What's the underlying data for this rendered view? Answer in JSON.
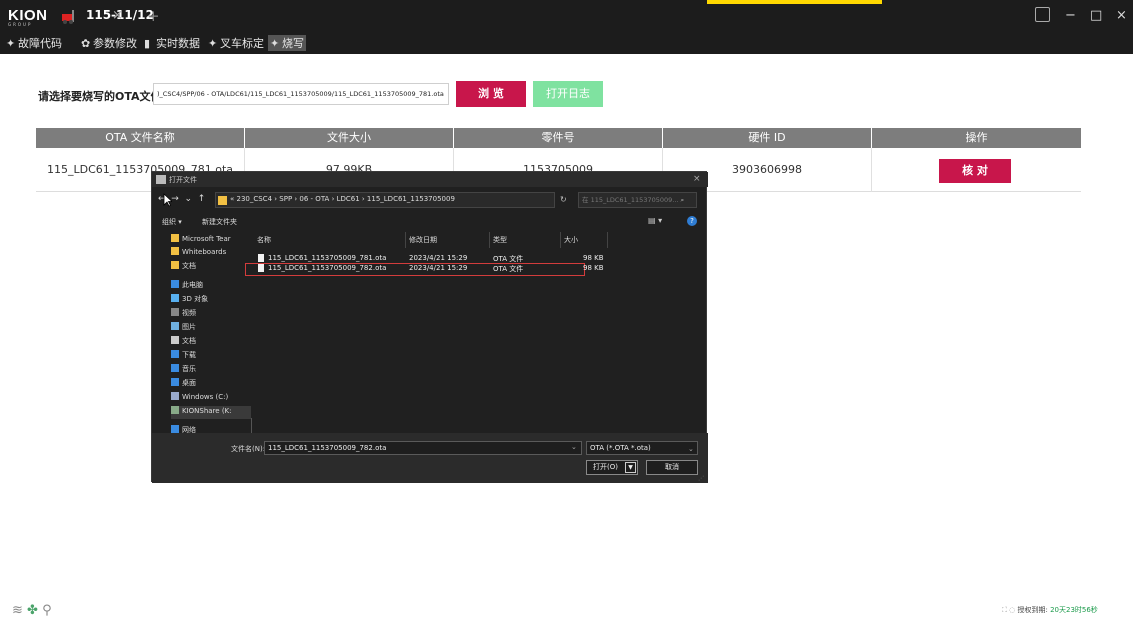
{
  "window": {
    "logo": "KION",
    "logo_sub": "GROUP",
    "tab_label": "115-11/12",
    "tab_close": "×",
    "tab_add": "+",
    "minimize": "−",
    "maximize": "□",
    "close": "×"
  },
  "menu": {
    "items": [
      {
        "label": "故障代码",
        "icon": "wrench-icon"
      },
      {
        "label": "参数修改",
        "icon": "gear-icon"
      },
      {
        "label": "实时数据",
        "icon": "bar-chart-icon"
      },
      {
        "label": "叉车标定",
        "icon": "wrench-icon"
      },
      {
        "label": "烧写",
        "icon": "flash-icon"
      }
    ],
    "active_index": 4
  },
  "main": {
    "select_label": "请选择要烧写的OTA文件",
    "path_value": ")_CSC4/SPP/06 - OTA/LDC61/115_LDC61_1153705009/115_LDC61_1153705009_781.ota",
    "browse_label": "浏 览",
    "log_label": "打开日志"
  },
  "table": {
    "headers": [
      "OTA 文件名称",
      "文件大小",
      "零件号",
      "硬件 ID",
      "操作"
    ],
    "rows": [
      {
        "file_name": "115_LDC61_1153705009_781.ota",
        "size": "97.99KB",
        "part_no": "1153705009",
        "hw_id": "3903606998",
        "action": "核 对"
      }
    ]
  },
  "status": {
    "license_label": "授权到期:",
    "license_value": "20天23时56秒"
  },
  "dialog": {
    "title": "打开文件",
    "close": "×",
    "breadcrumb": "« 230_CSC4 › SPP › 06 - OTA › LDC61 › 115_LDC61_1153705009",
    "search_placeholder": "在 115_LDC61_1153705009... ",
    "organize": "组织 ▾",
    "new_folder": "新建文件夹",
    "nav_items": [
      {
        "label": "Microsoft Tear",
        "icon": "folder-icon"
      },
      {
        "label": "Whiteboards",
        "icon": "folder-icon"
      },
      {
        "label": "文档",
        "icon": "folder-icon"
      },
      {
        "label": "此电脑",
        "icon": "pc-icon"
      },
      {
        "label": "3D 对象",
        "icon": "3d-icon"
      },
      {
        "label": "视频",
        "icon": "video-icon"
      },
      {
        "label": "图片",
        "icon": "picture-icon"
      },
      {
        "label": "文档",
        "icon": "document-icon"
      },
      {
        "label": "下载",
        "icon": "download-icon"
      },
      {
        "label": "音乐",
        "icon": "music-icon"
      },
      {
        "label": "桌面",
        "icon": "desktop-icon"
      },
      {
        "label": "Windows (C:)",
        "icon": "drive-icon"
      },
      {
        "label": "KIONShare (K:",
        "icon": "network-drive-icon"
      },
      {
        "label": "网络",
        "icon": "network-icon"
      }
    ],
    "columns": [
      "名称",
      "修改日期",
      "类型",
      "大小"
    ],
    "files": [
      {
        "name": "115_LDC61_1153705009_781.ota",
        "date": "2023/4/21 15:29",
        "type": "OTA 文件",
        "size": "98 KB"
      },
      {
        "name": "115_LDC61_1153705009_782.ota",
        "date": "2023/4/21 15:29",
        "type": "OTA 文件",
        "size": "98 KB"
      }
    ],
    "selected_file_index": 1,
    "filename_label": "文件名(N):",
    "filename_value": "115_LDC61_1153705009_782.ota",
    "filetype_value": "OTA (*.OTA *.ota)",
    "open_label": "打开(O)",
    "cancel_label": "取消"
  },
  "colors": {
    "accent": "#c8164b",
    "log_button": "#7fe2a0",
    "titlebar": "#1c1c1c",
    "table_header": "#7d7d7d",
    "selection_outline": "#d33c3c"
  }
}
